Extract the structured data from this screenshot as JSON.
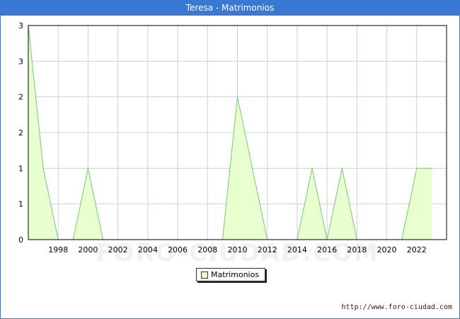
{
  "title": "Teresa - Matrimonios",
  "watermark": "FORO-CIUDAD.COM",
  "source_url": "http://www.foro-ciudad.com",
  "colors": {
    "header": "#3a78d6",
    "area_fill": "#e8ffd0",
    "line": "#7cc47c",
    "grid": "#d0d0d0"
  },
  "chart_data": {
    "type": "area",
    "title": "Teresa - Matrimonios",
    "series": [
      {
        "name": "Matrimonios",
        "x": [
          1996,
          1997,
          1998,
          1999,
          2000,
          2001,
          2002,
          2003,
          2004,
          2005,
          2006,
          2007,
          2008,
          2009,
          2010,
          2011,
          2012,
          2013,
          2014,
          2015,
          2016,
          2017,
          2018,
          2019,
          2020,
          2021,
          2022,
          2023
        ],
        "values": [
          3,
          1,
          0,
          0,
          1,
          0,
          0,
          0,
          0,
          0,
          0,
          0,
          0,
          0,
          2,
          1,
          0,
          0,
          0,
          1,
          0,
          1,
          0,
          0,
          0,
          0,
          1,
          1
        ]
      }
    ],
    "x_ticks": [
      "1998",
      "2000",
      "2002",
      "2004",
      "2006",
      "2008",
      "2010",
      "2012",
      "2014",
      "2016",
      "2018",
      "2020",
      "2022"
    ],
    "y_tick_labels": [
      "0",
      "1",
      "1",
      "2",
      "2",
      "3",
      "3"
    ],
    "xlim": [
      1996,
      2024
    ],
    "ylim": [
      0,
      3
    ],
    "legend": [
      "Matrimonios"
    ],
    "legend_position": "bottom-center",
    "grid": true
  }
}
